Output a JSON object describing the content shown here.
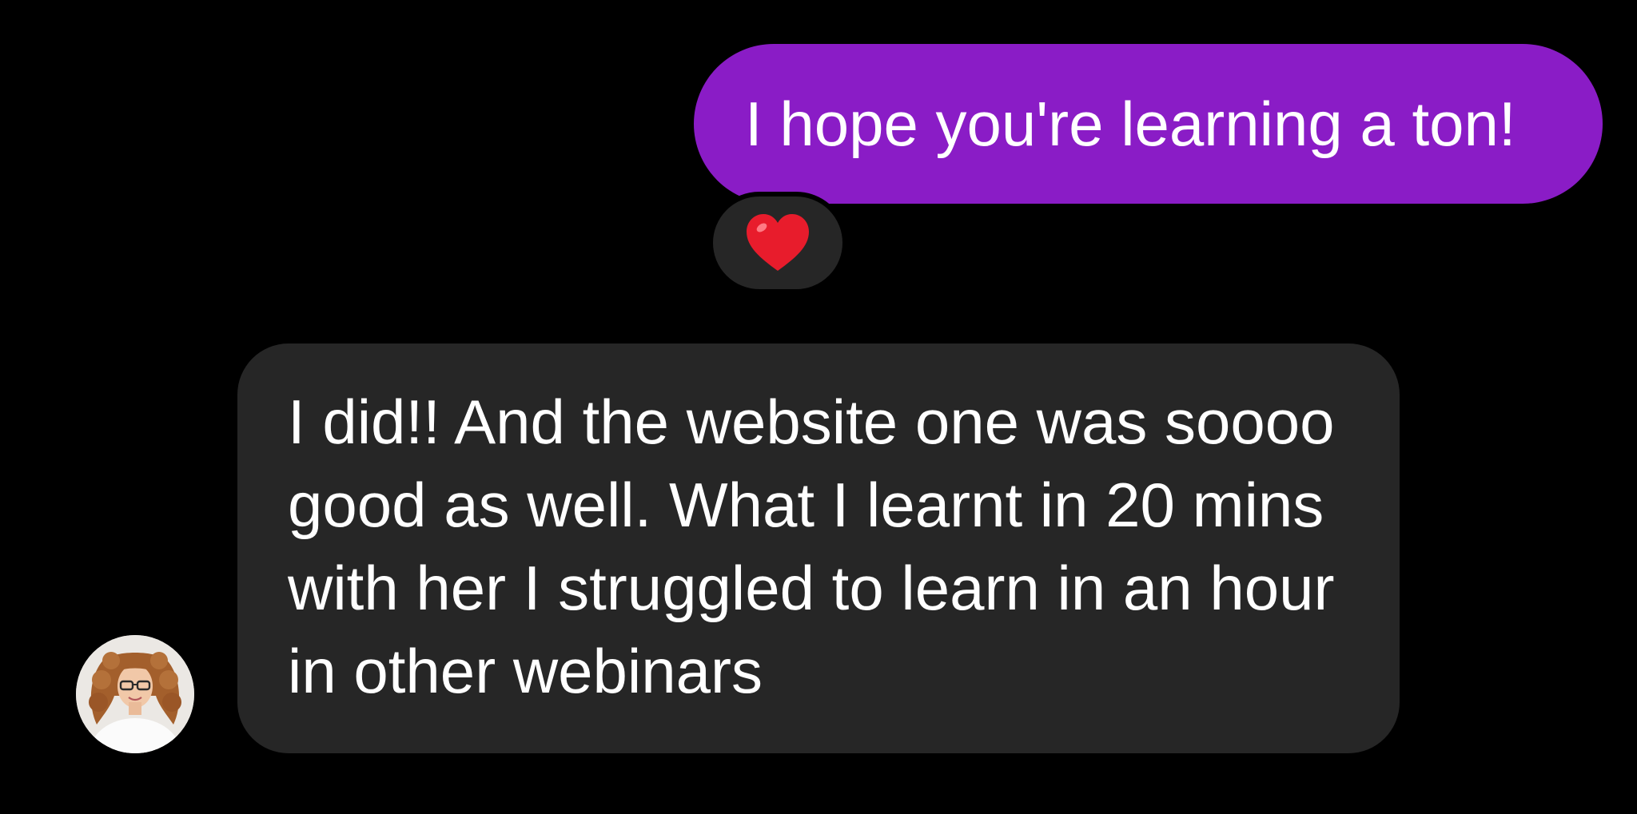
{
  "thread": {
    "messages": [
      {
        "direction": "outgoing",
        "text": "I hope you're learning a ton!",
        "reaction": {
          "emoji": "❤️",
          "icon": "heart-icon",
          "color": "#E81C2C"
        }
      },
      {
        "direction": "incoming",
        "text": "I did!! And the website one was soooo good as well. What I learnt in 20 mins with her I struggled to learn in an hour in other webinars",
        "sender_avatar": "avatar-woman-curly-hair-glasses"
      }
    ]
  },
  "colors": {
    "background": "#000000",
    "outgoing_bubble": "#8A1CC6",
    "incoming_bubble": "#262626",
    "text": "#FFFFFF"
  }
}
